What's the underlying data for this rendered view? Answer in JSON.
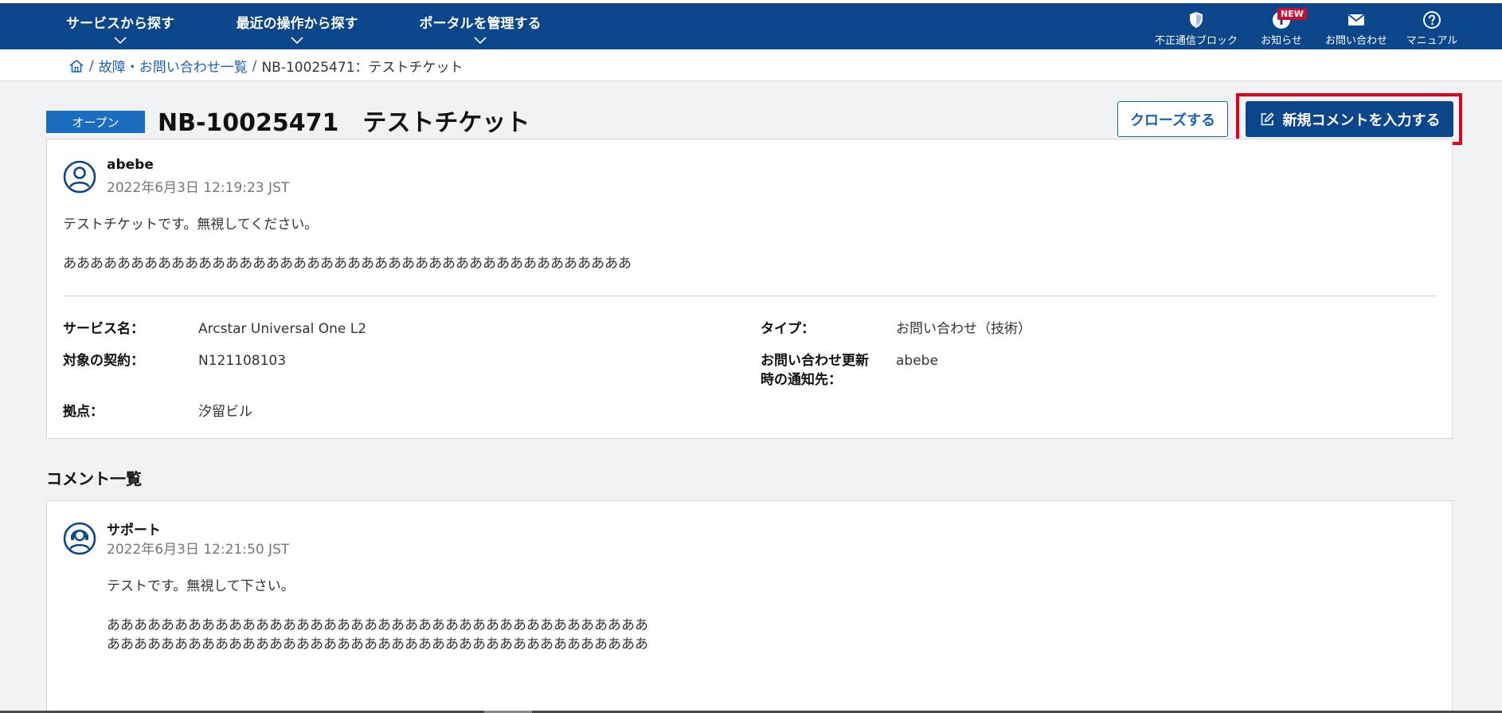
{
  "nav": {
    "menus": [
      {
        "label": "サービスから探す"
      },
      {
        "label": "最近の操作から探す"
      },
      {
        "label": "ポータルを管理する"
      }
    ],
    "tools": [
      {
        "label": "不正通信ブロック",
        "icon": "shield-icon"
      },
      {
        "label": "お知らせ",
        "icon": "info-icon",
        "badge": "NEW"
      },
      {
        "label": "お問い合わせ",
        "icon": "mail-icon"
      },
      {
        "label": "マニュアル",
        "icon": "help-icon"
      }
    ]
  },
  "breadcrumb": {
    "sep": "/",
    "link": "故障・お問い合わせ一覧",
    "current": "NB-10025471：テストチケット"
  },
  "ticket": {
    "status": "オープン",
    "title": "NB-10025471　テストチケット",
    "close_label": "クローズする",
    "new_comment_label": "新規コメントを入力する",
    "author": "abebe",
    "timestamp": "2022年6月3日 12:19:23 JST",
    "body_line1": "テストチケットです。無視してください。",
    "body_line2": "ああああああああああああああああああああああああああああああああああああああああああ",
    "fields": {
      "service_label": "サービス名：",
      "service_value": "Arcstar Universal One L2",
      "contract_label": "対象の契約：",
      "contract_value": "N121108103",
      "site_label": "拠点：",
      "site_value": "汐留ビル",
      "type_label": "タイプ：",
      "type_value": "お問い合わせ（技術）",
      "notify_label_line1": "お問い合わせ更新",
      "notify_label_line2": "時の通知先：",
      "notify_value": "abebe"
    }
  },
  "comments": {
    "section_title": "コメント一覧",
    "items": [
      {
        "author": "サポート",
        "timestamp": "2022年6月3日 12:21:50 JST",
        "line1": "テストです。無視して下さい。",
        "line2": "ああああああああああああああああああああああああああああああああああああああああ",
        "line3": "ああああああああああああああああああああああああああああああああああああああああ"
      }
    ]
  },
  "colors": {
    "nav_bg": "#0b468a",
    "accent": "#1b62b3",
    "status_tag": "#1b6dc1",
    "highlight": "#e0001b",
    "badge": "#c8102e"
  }
}
